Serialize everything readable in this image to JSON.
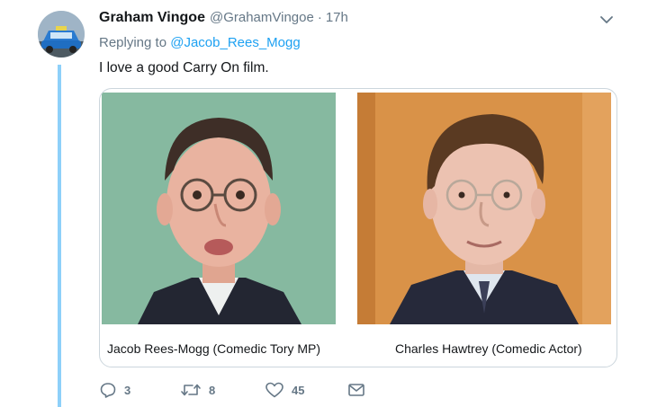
{
  "tweet": {
    "author_name": "Graham Vingoe",
    "author_handle": "@GrahamVingoe",
    "separator": "·",
    "timestamp": "17h",
    "replying_prefix": "Replying to",
    "replying_to": "@Jacob_Rees_Mogg",
    "text": "I love a good Carry On film."
  },
  "media": {
    "left_caption": "Jacob Rees-Mogg (Comedic Tory MP)",
    "right_caption": "Charles Hawtrey (Comedic Actor)"
  },
  "actions": {
    "reply_count": "3",
    "retweet_count": "8",
    "like_count": "45"
  },
  "icons": {
    "menu": "chevron-down-icon",
    "reply": "reply-icon",
    "retweet": "retweet-icon",
    "like": "heart-icon",
    "dm": "envelope-icon"
  },
  "colors": {
    "link": "#1da1f2",
    "thread_line": "#8ed0f9",
    "secondary_text": "#657786"
  }
}
